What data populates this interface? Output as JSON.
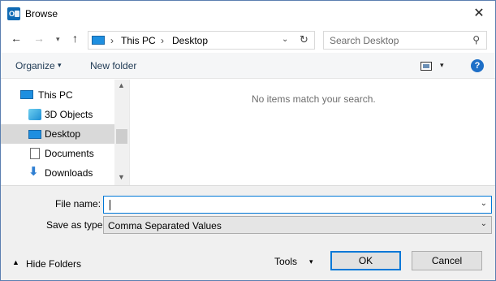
{
  "window": {
    "title": "Browse",
    "app_icon_text": "O",
    "close_glyph": "✕"
  },
  "nav": {
    "back_glyph": "←",
    "forward_glyph": "→",
    "recent_glyph": "▾",
    "up_glyph": "↑",
    "breadcrumb": [
      "This PC",
      "Desktop"
    ],
    "separator": "›",
    "dropdown_glyph": "⌄",
    "refresh_glyph": "↻"
  },
  "search": {
    "placeholder": "Search Desktop",
    "icon": "search-icon",
    "glyph": "⚲"
  },
  "toolbar": {
    "organize_label": "Organize",
    "caret_glyph": "▾",
    "new_folder_label": "New folder",
    "help_glyph": "?"
  },
  "tree": {
    "items": [
      {
        "label": "This PC",
        "icon": "pc-icon",
        "selected": false
      },
      {
        "label": "3D Objects",
        "icon": "3d-objects-icon",
        "selected": false
      },
      {
        "label": "Desktop",
        "icon": "desktop-icon",
        "selected": true
      },
      {
        "label": "Documents",
        "icon": "documents-icon",
        "selected": false
      },
      {
        "label": "Downloads",
        "icon": "downloads-icon",
        "selected": false
      }
    ],
    "downloads_glyph": "⬇",
    "scroll_up_glyph": "▲",
    "scroll_down_glyph": "▼"
  },
  "content": {
    "empty_message": "No items match your search."
  },
  "form": {
    "file_name_label": "File name:",
    "file_name_value": "",
    "save_as_type_label": "Save as type:",
    "save_as_type_value": "Comma Separated Values",
    "dropdown_glyph": "⌄"
  },
  "footer": {
    "hide_folders_glyph": "▲",
    "hide_folders_label": "Hide Folders",
    "tools_label": "Tools",
    "tools_caret": "▾",
    "ok_label": "OK",
    "cancel_label": "Cancel"
  },
  "colors": {
    "accent": "#0078d7",
    "selected_row": "#d9d9d9",
    "help": "#1e6fc7"
  }
}
